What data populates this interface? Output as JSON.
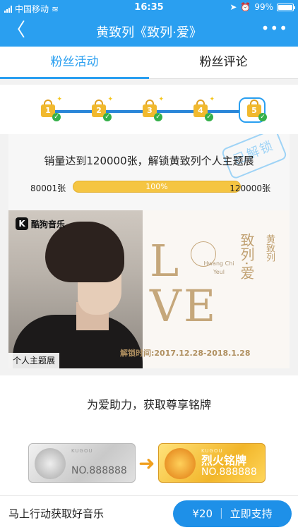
{
  "status_bar": {
    "carrier": "中国移动",
    "time": "16:35",
    "battery": "99%"
  },
  "nav": {
    "back_icon": "chevron-left-icon",
    "title": "黄致列《致列·爱》",
    "more_icon": "more-dots-icon",
    "more_glyph": "•••",
    "back_glyph": "〈"
  },
  "tabs": [
    {
      "label": "粉丝活动",
      "active": true
    },
    {
      "label": "粉丝评论",
      "active": false
    }
  ],
  "milestones": [
    {
      "num": "1",
      "unlocked": true
    },
    {
      "num": "2",
      "unlocked": true
    },
    {
      "num": "3",
      "unlocked": true
    },
    {
      "num": "4",
      "unlocked": true
    },
    {
      "num": "5",
      "unlocked": true,
      "current": true
    }
  ],
  "unlock": {
    "text": "销量达到120000张，解锁黄致列个人主题展",
    "stamp": "已解锁",
    "progress_min": "80001张",
    "progress_max": "120000张",
    "progress_label": "100%",
    "progress_fraction": 1.0
  },
  "banner": {
    "logo_text": "酷狗音乐",
    "tag": "个人主题展",
    "love_text": "LOVE",
    "english_name": "Hwang Chi Yeul",
    "album_title": "致列·爱",
    "artist": "黄致列",
    "unlock_time": "解锁时间:2017.12.28-2018.1.28"
  },
  "section2": {
    "title": "为爱助力，获取尊享铭牌",
    "silver_plate": {
      "kugou": "KUGOU",
      "no": "NO.888888"
    },
    "gold_plate": {
      "kugou": "KUGOU",
      "name": "烈火铭牌",
      "no": "NO.888888"
    }
  },
  "bottom": {
    "text": "马上行动获取好音乐",
    "button": "¥20 ｜ 立即支持"
  },
  "colors": {
    "primary": "#2a9ff0",
    "progress": "#f5c542",
    "check": "#35b04a"
  }
}
